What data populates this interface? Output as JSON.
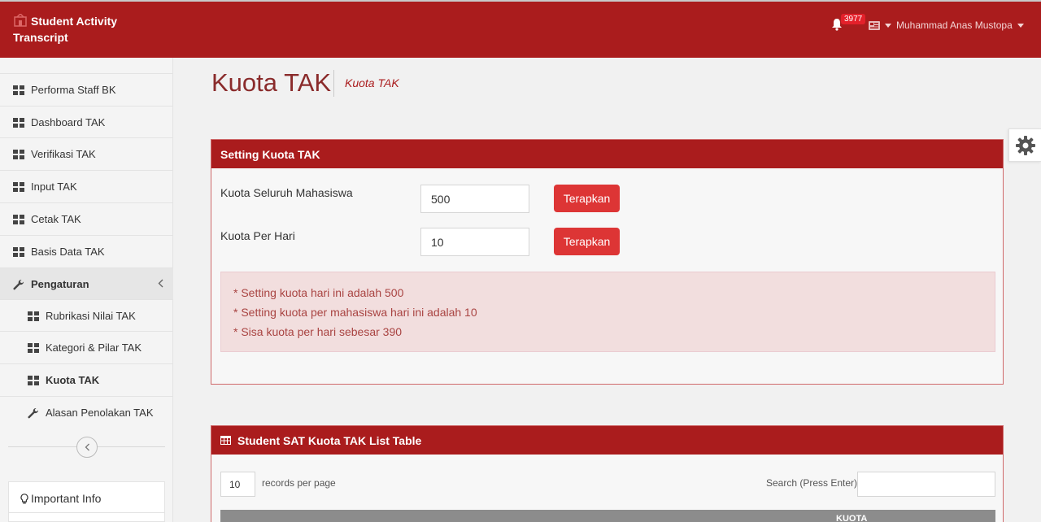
{
  "header": {
    "brand": "Student Activity Transcript",
    "notification_count": "3977",
    "user_name": "Muhammad Anas Mustopa"
  },
  "sidebar": {
    "items": [
      {
        "label": "Performa Staff BK"
      },
      {
        "label": "Dashboard TAK"
      },
      {
        "label": "Verifikasi TAK"
      },
      {
        "label": "Input TAK"
      },
      {
        "label": "Cetak TAK"
      },
      {
        "label": "Basis Data TAK"
      },
      {
        "label": "Pengaturan"
      },
      {
        "label": "Rubrikasi Nilai TAK"
      },
      {
        "label": "Kategori & Pilar TAK"
      },
      {
        "label": "Kuota TAK"
      },
      {
        "label": "Alasan Penolakan TAK"
      }
    ],
    "important_info": "Important Info"
  },
  "page": {
    "title": "Kuota TAK",
    "subtitle": "Kuota TAK"
  },
  "setting_panel": {
    "title": "Setting Kuota TAK",
    "fields": [
      {
        "label": "Kuota Seluruh Mahasiswa",
        "value": "500",
        "button": "Terapkan"
      },
      {
        "label": "Kuota Per Hari",
        "value": "10",
        "button": "Terapkan"
      }
    ],
    "notes": [
      "* Setting kuota hari ini adalah 500",
      "* Setting kuota per mahasiswa hari ini adalah 10",
      "* Sisa kuota per hari sebesar 390"
    ]
  },
  "table_panel": {
    "title": "Student SAT Kuota TAK List Table",
    "records_per_page": "10",
    "records_label": "records per page",
    "search_label": "Search (Press Enter):",
    "search_value": "",
    "column_header": "KUOTA"
  },
  "colors": {
    "brand_red": "#aa1c1d",
    "button_red": "#dd3535",
    "alert_bg": "#f2dede",
    "alert_text": "#a94442"
  },
  "icons": [
    "bell-icon",
    "grid-icon",
    "wrench-icon",
    "chevron-left-icon",
    "gear-icon",
    "table-icon",
    "lightbulb-icon",
    "user-card-icon",
    "caret-down-icon"
  ]
}
